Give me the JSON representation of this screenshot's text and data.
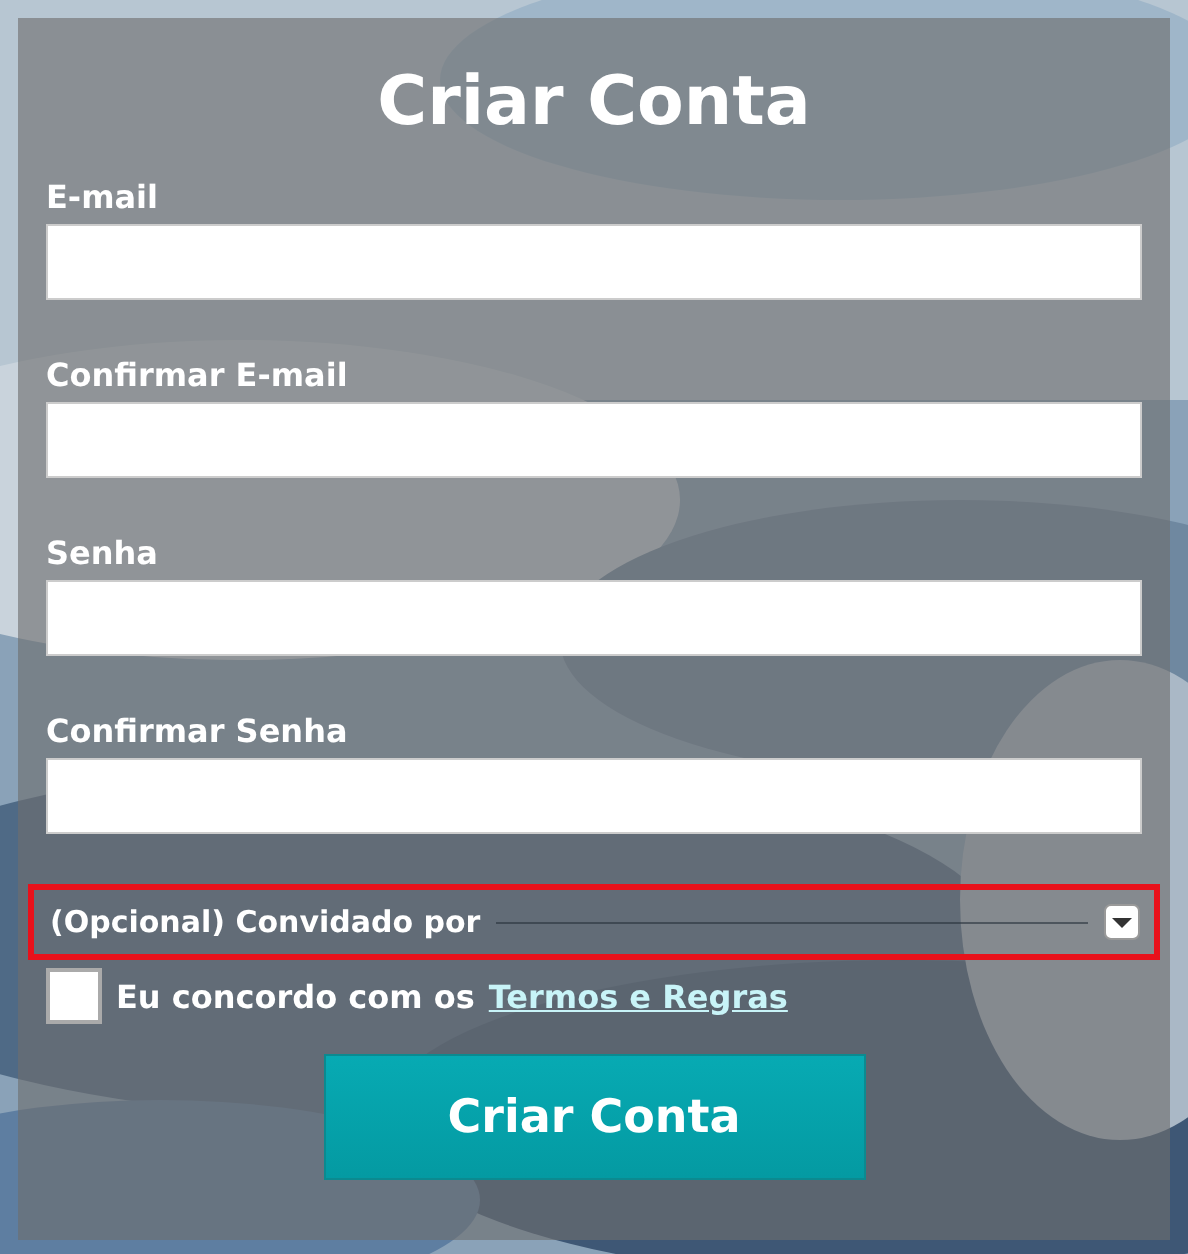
{
  "title": "Criar Conta",
  "fields": [
    {
      "label": "E-mail"
    },
    {
      "label": "Confirmar E-mail"
    },
    {
      "label": "Senha"
    },
    {
      "label": "Confirmar Senha"
    }
  ],
  "referral": {
    "placeholder": "(Opcional) Convidado por",
    "focused": true
  },
  "agree": {
    "checked": false,
    "text": "Eu concordo com os",
    "link": "Termos e Regras"
  },
  "submit": "Criar Conta"
}
